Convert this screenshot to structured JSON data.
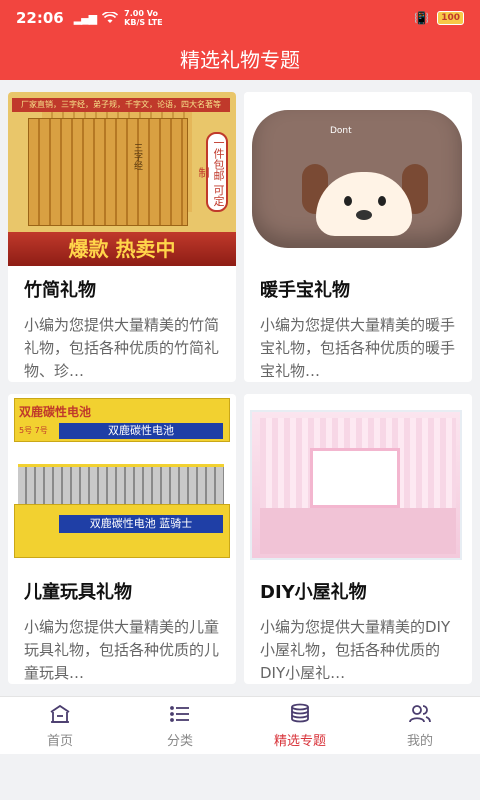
{
  "status_bar": {
    "time": "22:06",
    "network_speed": "7.00",
    "network_unit": "KB/S",
    "network_prefix": "Vo",
    "network_type": "LTE",
    "battery": "100"
  },
  "header": {
    "title": "精选礼物专题"
  },
  "cards": [
    {
      "title": "竹简礼物",
      "desc": "小编为您提供大量精美的竹简礼物，包括各种优质的竹简礼物、珍…",
      "image": {
        "top_text": "厂家直销，三字经，弟子规，千字文，论语，四大名著等",
        "seal_text": "一件包邮 可定制",
        "banner_text": "爆款 热卖中",
        "slip_text": "三字经"
      }
    },
    {
      "title": "暖手宝礼物",
      "desc": "小编为您提供大量精美的暖手宝礼物，包括各种优质的暖手宝礼物…",
      "image": {
        "tag_text": "Dont"
      }
    },
    {
      "title": "儿童玩具礼物",
      "desc": "小编为您提供大量精美的儿童玩具礼物，包括各种优质的儿童玩具…",
      "image": {
        "brand_top": "双鹿碳性电池",
        "brand_front": "双鹿碳性电池 蓝骑士",
        "size_top": "5号 7号"
      }
    },
    {
      "title": "DIY小屋礼物",
      "desc": "小编为您提供大量精美的DIY小屋礼物，包括各种优质的DIY小屋礼…",
      "image": {}
    }
  ],
  "bottom_nav": [
    {
      "label": "首页",
      "icon": "home-icon",
      "active": false
    },
    {
      "label": "分类",
      "icon": "list-icon",
      "active": false
    },
    {
      "label": "精选专题",
      "icon": "coins-stack-icon",
      "active": true
    },
    {
      "label": "我的",
      "icon": "users-icon",
      "active": false
    }
  ],
  "colors": {
    "primary": "#f2453f",
    "active_tab": "#d8333a",
    "icon": "#4a3d6e",
    "background": "#f1f2f4"
  }
}
